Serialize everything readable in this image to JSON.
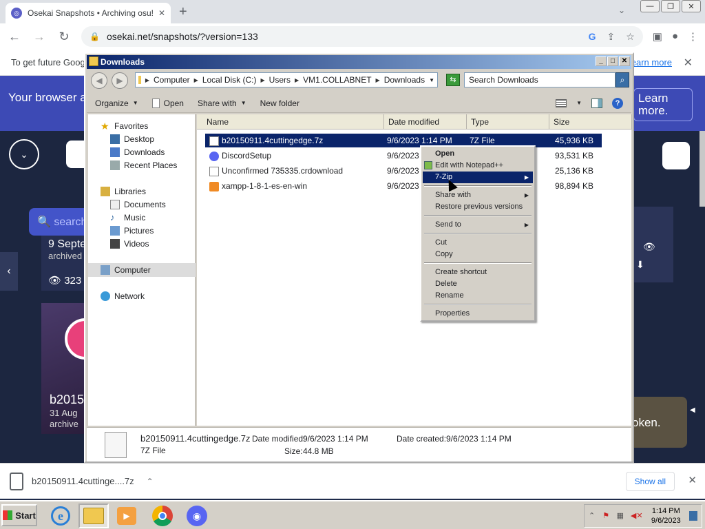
{
  "browser": {
    "tab_title": "Osekai Snapshots • Archiving osu! v",
    "url": "osekai.net/snapshots/?version=133",
    "infobar_text": "To get future Google",
    "infobar_link": "earn more"
  },
  "site": {
    "banner_text": "Your browser automatically",
    "banner_btn": "Learn more.",
    "search_placeholder": "search",
    "card1_date": "9 Septe",
    "card1_sub": "archived",
    "card1_views": "323",
    "card2_title": "b2015",
    "card2_date": "31 Aug",
    "card2_sub": "archive",
    "toast_text": "oken."
  },
  "explorer": {
    "title": "Downloads",
    "breadcrumbs": [
      "Computer",
      "Local Disk (C:)",
      "Users",
      "VM1.COLLABNET",
      "Downloads"
    ],
    "search_placeholder": "Search Downloads",
    "commands": {
      "organize": "Organize",
      "open": "Open",
      "share": "Share with",
      "new_folder": "New folder"
    },
    "nav": {
      "favorites": "Favorites",
      "desktop": "Desktop",
      "downloads": "Downloads",
      "recent": "Recent Places",
      "libraries": "Libraries",
      "documents": "Documents",
      "music": "Music",
      "pictures": "Pictures",
      "videos": "Videos",
      "computer": "Computer",
      "network": "Network"
    },
    "columns": {
      "name": "Name",
      "date": "Date modified",
      "type": "Type",
      "size": "Size"
    },
    "files": [
      {
        "name": "b20150911.4cuttingedge.7z",
        "date": "9/6/2023 1:14 PM",
        "type": "7Z File",
        "size": "45,936 KB"
      },
      {
        "name": "DiscordSetup",
        "date": "9/6/2023",
        "type": "",
        "size": "93,531 KB"
      },
      {
        "name": "Unconfirmed 735335.crdownload",
        "date": "9/6/2023",
        "type": "",
        "size": "25,136 KB"
      },
      {
        "name": "xampp-1-8-1-es-en-win",
        "date": "9/6/2023",
        "type": "",
        "size": "98,894 KB"
      }
    ],
    "details": {
      "name": "b20150911.4cuttingedge.7z",
      "type": "7Z File",
      "modified_label": "Date modified:",
      "modified": "9/6/2023 1:14 PM",
      "created_label": "Date created:",
      "created": "9/6/2023 1:14 PM",
      "size_label": "Size:",
      "size": "44.8 MB"
    }
  },
  "context_menu": {
    "open": "Open",
    "notepad": "Edit with Notepad++",
    "zip": "7-Zip",
    "share": "Share with",
    "restore": "Restore previous versions",
    "send_to": "Send to",
    "cut": "Cut",
    "copy": "Copy",
    "shortcut": "Create shortcut",
    "delete": "Delete",
    "rename": "Rename",
    "properties": "Properties"
  },
  "downloads_bar": {
    "file": "b20150911.4cuttinge....7z",
    "show_all": "Show all"
  },
  "taskbar": {
    "start": "Start",
    "time": "1:14 PM",
    "date": "9/6/2023"
  }
}
